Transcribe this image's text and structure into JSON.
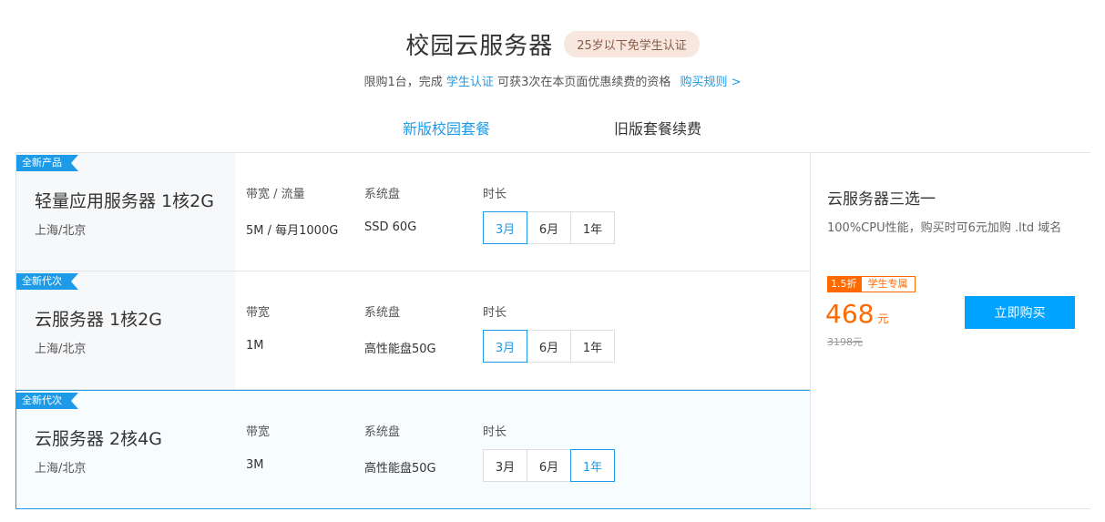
{
  "header": {
    "title": "校园云服务器",
    "badge": "25岁以下免学生认证",
    "subtitle_pre": "限购1台，完成",
    "subtitle_link": "学生认证",
    "subtitle_post": "可获3次在本页面优惠续费的资格",
    "rules_link": "购买规则 >"
  },
  "tabs": [
    {
      "label": "新版校园套餐",
      "active": true
    },
    {
      "label": "旧版套餐续费",
      "active": false
    }
  ],
  "products": [
    {
      "ribbon": "全新产品",
      "name": "轻量应用服务器 1核2G",
      "region": "上海/北京",
      "bandwidth_label": "带宽 / 流量",
      "bandwidth_value": "5M / 每月1000G",
      "disk_label": "系统盘",
      "disk_value": "SSD 60G",
      "duration_label": "时长",
      "durations": [
        "3月",
        "6月",
        "1年"
      ],
      "selected_duration": "3月"
    },
    {
      "ribbon": "全新代次",
      "name": "云服务器 1核2G",
      "region": "上海/北京",
      "bandwidth_label": "带宽",
      "bandwidth_value": "1M",
      "disk_label": "系统盘",
      "disk_value": "高性能盘50G",
      "duration_label": "时长",
      "durations": [
        "3月",
        "6月",
        "1年"
      ],
      "selected_duration": "3月"
    },
    {
      "ribbon": "全新代次",
      "name": "云服务器 2核4G",
      "region": "上海/北京",
      "bandwidth_label": "带宽",
      "bandwidth_value": "3M",
      "disk_label": "系统盘",
      "disk_value": "高性能盘50G",
      "duration_label": "时长",
      "durations": [
        "3月",
        "6月",
        "1年"
      ],
      "selected_duration": "1年"
    }
  ],
  "sidecard": {
    "title": "云服务器三选一",
    "desc": "100%CPU性能，购买时可6元加购 .ltd 域名",
    "discount_tag": "1.5折",
    "student_tag": "学生专属",
    "price": "468",
    "price_unit": "元",
    "orig_price": "3198元",
    "buy_label": "立即购买"
  },
  "colors": {
    "accent": "#1e9be8",
    "price": "#ff6a00",
    "buy_button": "#00a3ff"
  }
}
